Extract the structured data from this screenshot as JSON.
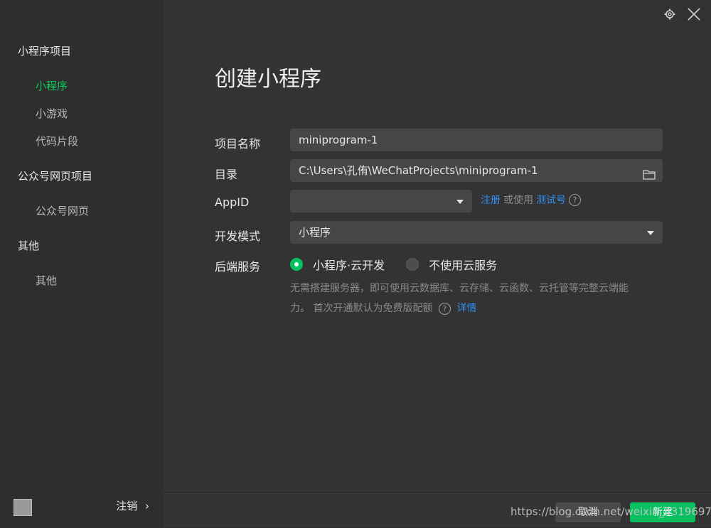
{
  "sidebar": {
    "sections": [
      {
        "title": "小程序项目",
        "items": [
          {
            "label": "小程序",
            "active": true
          },
          {
            "label": "小游戏"
          },
          {
            "label": "代码片段"
          }
        ]
      },
      {
        "title": "公众号网页项目",
        "items": [
          {
            "label": "公众号网页"
          }
        ]
      },
      {
        "title": "其他",
        "items": [
          {
            "label": "其他"
          }
        ]
      }
    ],
    "footer": {
      "logout_label": "注销"
    }
  },
  "main": {
    "title": "创建小程序",
    "fields": {
      "project_name": {
        "label": "项目名称",
        "value": "miniprogram-1"
      },
      "directory": {
        "label": "目录",
        "value": "C:\\Users\\孔侑\\WeChatProjects\\miniprogram-1"
      },
      "appid": {
        "label": "AppID",
        "value": "",
        "register": "注册",
        "or_use": "或使用",
        "test_account": "测试号"
      },
      "dev_mode": {
        "label": "开发模式",
        "value": "小程序"
      },
      "backend": {
        "label": "后端服务",
        "options": [
          {
            "label": "小程序·云开发",
            "checked": true
          },
          {
            "label": "不使用云服务",
            "checked": false
          }
        ],
        "desc_line1": "无需搭建服务器，即可使用云数据库、云存储、云函数、云托管等完整云端能",
        "desc_line2": "力。 首次开通默认为免费版配额",
        "details": "详情"
      }
    },
    "buttons": {
      "cancel": "取消",
      "create": "新建"
    }
  },
  "watermark": "https://blog.csdn.net/weixin_4319697",
  "colors": {
    "accent": "#07c160",
    "link": "#2f8ff5",
    "sidebar_bg": "#2e2e2e",
    "main_bg": "#333333",
    "input_bg": "#464646"
  }
}
